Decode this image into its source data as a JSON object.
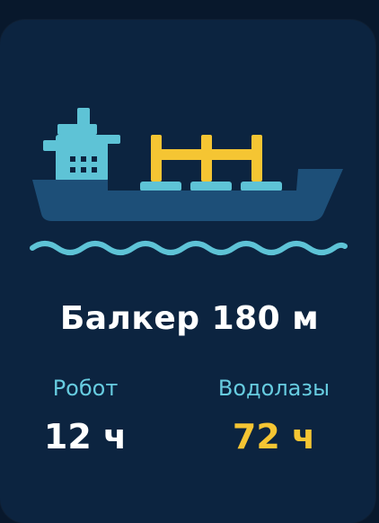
{
  "colors": {
    "background": "#08182c",
    "card": "#0c2440",
    "hull": "#1d4f78",
    "superstructure": "#5ec3d6",
    "cranes": "#f5c533",
    "waves": "#5ec3d6",
    "label": "#67cce0",
    "value_highlight": "#f5c533"
  },
  "illustration": {
    "icon": "bulk-carrier-ship-icon"
  },
  "title": "Балкер 180 м",
  "stats": [
    {
      "label": "Робот",
      "value": "12 ч"
    },
    {
      "label": "Водолазы",
      "value": "72 ч"
    }
  ]
}
